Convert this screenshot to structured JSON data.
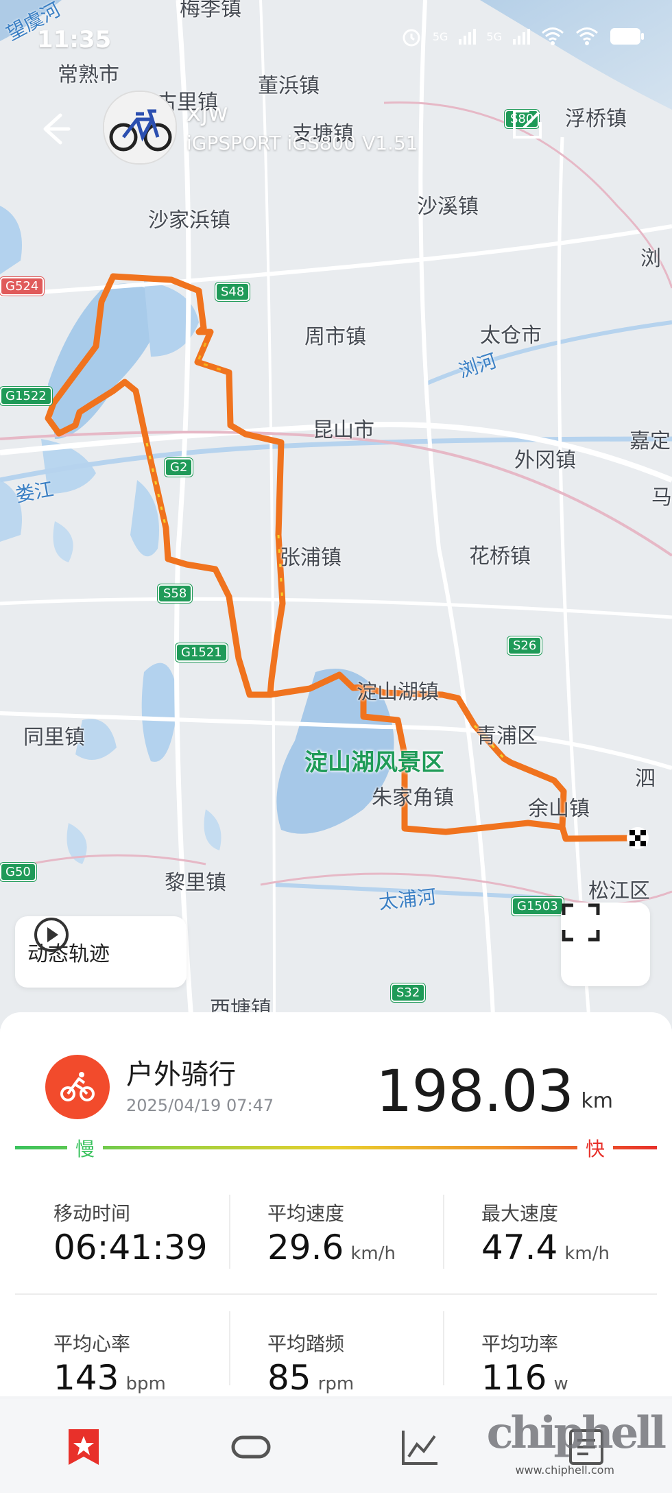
{
  "status_bar": {
    "time": "11:35",
    "signal_1": "5G",
    "signal_2": "5G"
  },
  "header": {
    "user_name": "xjw",
    "device": "iGPSPORT iGS800  V1.51"
  },
  "map": {
    "places": [
      "梅李镇",
      "常熟市",
      "古里镇",
      "董浜镇",
      "支塘镇",
      "浮桥镇",
      "沙家浜镇",
      "沙溪镇",
      "浏",
      "周市镇",
      "太仓市",
      "昆山市",
      "嘉定",
      "外冈镇",
      "马",
      "张浦镇",
      "花桥镇",
      "淀山湖镇",
      "青浦区",
      "同里镇",
      "朱家角镇",
      "余山镇",
      "泗",
      "松江区",
      "黎里镇",
      "西塘镇",
      "望虞河"
    ],
    "water": [
      "浏河",
      "娄江",
      "太浦河"
    ],
    "scenic": "淀山湖风景区",
    "roads": [
      "S80",
      "G524",
      "S48",
      "G1522",
      "G2",
      "S58",
      "G1521",
      "S26",
      "G50",
      "G1503",
      "S32"
    ]
  },
  "controls": {
    "replay_label": "动态轨迹"
  },
  "activity": {
    "title": "户外骑行",
    "datetime": "2025/04/19 07:47",
    "distance": "198.03",
    "distance_unit": "km"
  },
  "speed_legend": {
    "slow": "慢",
    "fast": "快"
  },
  "stats": [
    {
      "label": "移动时间",
      "value": "06:41:39",
      "unit": ""
    },
    {
      "label": "平均速度",
      "value": "29.6",
      "unit": "km/h"
    },
    {
      "label": "最大速度",
      "value": "47.4",
      "unit": "km/h"
    },
    {
      "label": "平均心率",
      "value": "143",
      "unit": "bpm"
    },
    {
      "label": "平均踏频",
      "value": "85",
      "unit": "rpm"
    },
    {
      "label": "平均功率",
      "value": "116",
      "unit": "w"
    }
  ],
  "watermark": {
    "main": "chiphell",
    "url": "www.chiphell.com"
  },
  "colors": {
    "accent": "#f24b2c",
    "route": "#f07a1f",
    "slow": "#39c25d",
    "fast": "#e8302a"
  }
}
